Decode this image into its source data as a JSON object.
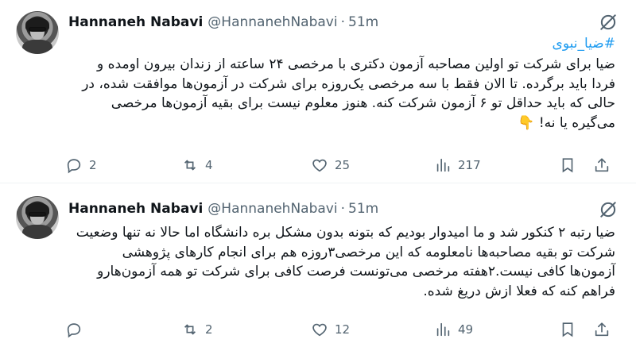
{
  "tweets": [
    {
      "author_name": "Hannaneh Nabavi",
      "handle": "@HannanehNabavi",
      "separator": "·",
      "time": "51m",
      "hashtag": "#ضیا_نبوی",
      "text": "ضیا برای شرکت تو اولین مصاحبه آزمون دکتری با مرخصی ۲۴ ساعته از زندان بیرون اومده و فردا باید برگرده. تا الان فقط با سه مرخصی یک‌روزه برای شرکت در آزمون‌ها موافقت شده، در حالی که باید حداقل تو ۶ آزمون شرکت کنه. هنوز معلوم نیست برای بقیه آزمون‌ها مرخصی می‌گیره یا نه! 👇",
      "replies": "2",
      "reposts": "4",
      "likes": "25",
      "views": "217"
    },
    {
      "author_name": "Hannaneh Nabavi",
      "handle": "@HannanehNabavi",
      "separator": "·",
      "time": "51m",
      "text": "ضیا رتبه ۲ کنکور شد و ما امیدوار بودیم که بتونه بدون مشکل بره دانشگاه اما حالا نه تنها وضعیت شرکت تو بقیه مصاحبه‌ها نامعلومه که این مرخصی۳روزه هم برای انجام کارهای پژوهشی آزمون‌ها کافی نیست.۲هفته مرخصی می‌تونست فرصت کافی برای شرکت تو همه آزمون‌هارو فراهم کنه که فعلا ازش دریغ شده.",
      "replies": "",
      "reposts": "2",
      "likes": "12",
      "views": "49"
    }
  ],
  "icons": {
    "grok": "grok-icon",
    "reply": "reply-icon",
    "repost": "repost-icon",
    "like": "heart-icon",
    "views": "views-icon",
    "bookmark": "bookmark-icon",
    "share": "share-icon"
  },
  "colors": {
    "accent": "#1d9bf0",
    "muted": "#536471",
    "text": "#0f1419"
  }
}
